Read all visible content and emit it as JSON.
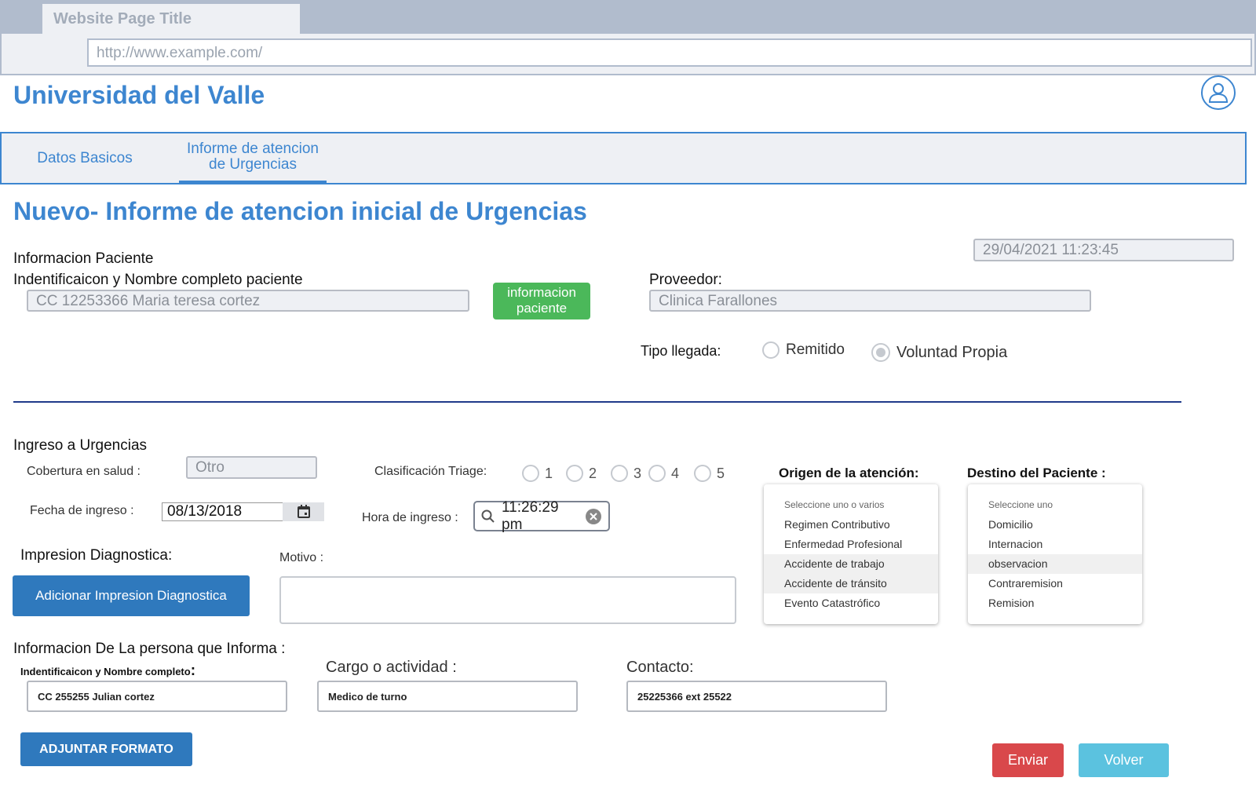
{
  "browser": {
    "tab_title": "Website Page Title",
    "url": "http://www.example.com/"
  },
  "header": {
    "brand": "Universidad del Valle",
    "user_icon": "user-icon"
  },
  "nav": {
    "tabs": [
      {
        "label": "Datos Basicos",
        "active": false
      },
      {
        "label_line1": "Informe de atencion",
        "label_line2": "de Urgencias",
        "active": true
      }
    ]
  },
  "page": {
    "title": "Nuevo- Informe de atencion inicial de Urgencias",
    "timestamp": "29/04/2021 11:23:45"
  },
  "patient": {
    "section_title": "Informacion Paciente",
    "id_label": "Indentificaicon y Nombre completo paciente",
    "id_value": "CC 12253366 Maria teresa cortez",
    "info_button_line1": "informacion",
    "info_button_line2": "paciente",
    "provider_label": "Proveedor:",
    "provider_value": "Clinica Farallones",
    "arrival_label": "Tipo llegada:",
    "arrival_options": [
      {
        "label": "Remitido",
        "selected": false
      },
      {
        "label": "Voluntad Propia",
        "selected": true
      }
    ]
  },
  "admission": {
    "section_title": "Ingreso a Urgencias",
    "coverage_label": "Cobertura en salud :",
    "coverage_value": "Otro",
    "triage_label": "Clasificación Triage:",
    "triage_options": [
      "1",
      "2",
      "3",
      "4",
      "5"
    ],
    "date_label": "Fecha de ingreso :",
    "date_value": "08/13/2018",
    "time_label": "Hora de ingreso :",
    "time_value": "11:26:29 pm",
    "diagnosis_label": "Impresion Diagnostica:",
    "diagnosis_button": "Adicionar Impresion Diagnostica",
    "reason_label": "Motivo :"
  },
  "origin": {
    "title": "Origen de la atención:",
    "hint": "Seleccione uno o varios",
    "items": [
      "Regimen Contributivo",
      "Enfermedad Profesional",
      "Accidente de trabajo",
      "Accidente de tránsito",
      "Evento Catastrófico"
    ],
    "highlighted": [
      2,
      3
    ]
  },
  "destination": {
    "title": "Destino del Paciente :",
    "hint": "Seleccione uno",
    "items": [
      "Domicilio",
      "Internacion",
      "observacion",
      "Contraremision",
      "Remision"
    ],
    "highlighted": [
      2
    ]
  },
  "informant": {
    "section_title": "Informacion De  La persona que Informa :",
    "id_label": "Indentificaicon y Nombre completo",
    "id_colon": ":",
    "id_value": "CC 255255 Julian cortez",
    "role_label": "Cargo o actividad :",
    "role_value": "Medico de turno",
    "contact_label": "Contacto:",
    "contact_value": "25225366 ext 25522"
  },
  "actions": {
    "attach": "ADJUNTAR FORMATO",
    "send": "Enviar",
    "back": "Volver"
  },
  "colors": {
    "primary": "#3d86d0",
    "green": "#4bb85a",
    "button_blue": "#2f79bd",
    "send_red": "#d9484b",
    "back_cyan": "#5bc2df",
    "divider": "#1f3a8a"
  }
}
